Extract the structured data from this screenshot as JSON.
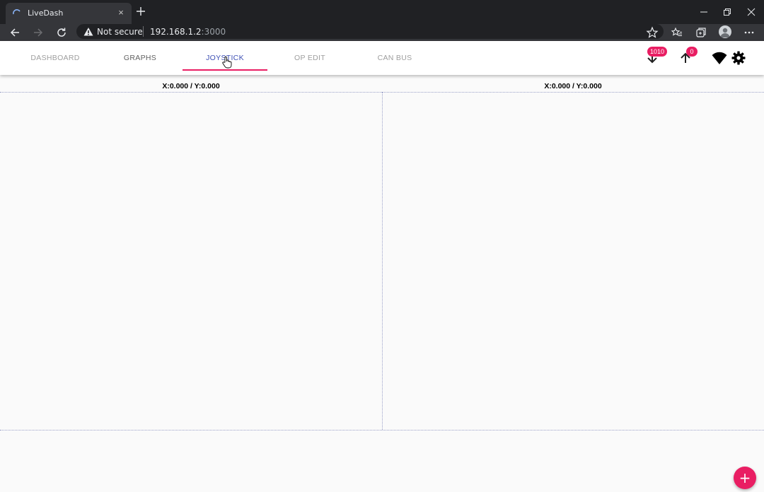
{
  "browser": {
    "tab_title": "LiveDash",
    "tab_close": "×",
    "security_label": "Not secure",
    "url_host": "192.168.1.2",
    "url_port": ":3000"
  },
  "nav": {
    "tabs": [
      {
        "label": "DASHBOARD"
      },
      {
        "label": "GRAPHS"
      },
      {
        "label": "JOYSTICK"
      },
      {
        "label": "OP EDIT"
      },
      {
        "label": "CAN BUS"
      }
    ],
    "active_tab": "JOYSTICK",
    "rx_count": "1010",
    "tx_count": "0"
  },
  "joysticks": {
    "left": {
      "readout": "X:0.000 / Y:0.000"
    },
    "right": {
      "readout": "X:0.000 / Y:0.000"
    }
  },
  "fab": {
    "label": "+"
  },
  "colors": {
    "accent": "#e91e63",
    "primary": "#3f51b5"
  }
}
